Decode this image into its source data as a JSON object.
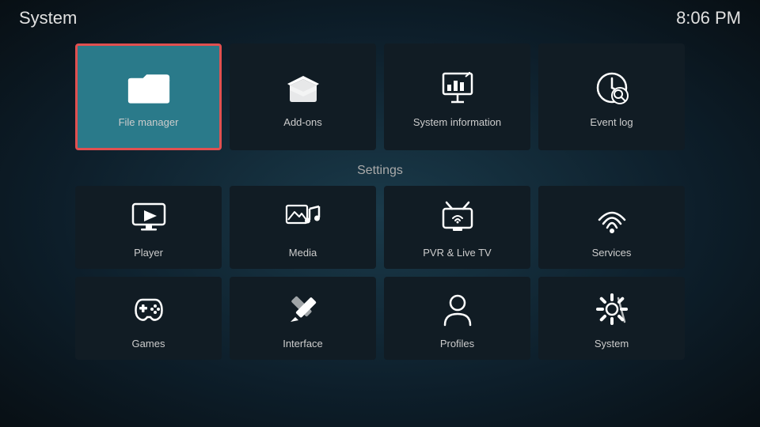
{
  "header": {
    "title": "System",
    "time": "8:06 PM"
  },
  "top_tiles": [
    {
      "id": "file-manager",
      "label": "File manager",
      "selected": true
    },
    {
      "id": "add-ons",
      "label": "Add-ons",
      "selected": false
    },
    {
      "id": "system-information",
      "label": "System information",
      "selected": false
    },
    {
      "id": "event-log",
      "label": "Event log",
      "selected": false
    }
  ],
  "settings": {
    "label": "Settings",
    "row1": [
      {
        "id": "player",
        "label": "Player"
      },
      {
        "id": "media",
        "label": "Media"
      },
      {
        "id": "pvr-live-tv",
        "label": "PVR & Live TV"
      },
      {
        "id": "services",
        "label": "Services"
      }
    ],
    "row2": [
      {
        "id": "games",
        "label": "Games"
      },
      {
        "id": "interface",
        "label": "Interface"
      },
      {
        "id": "profiles",
        "label": "Profiles"
      },
      {
        "id": "system",
        "label": "System"
      }
    ]
  }
}
